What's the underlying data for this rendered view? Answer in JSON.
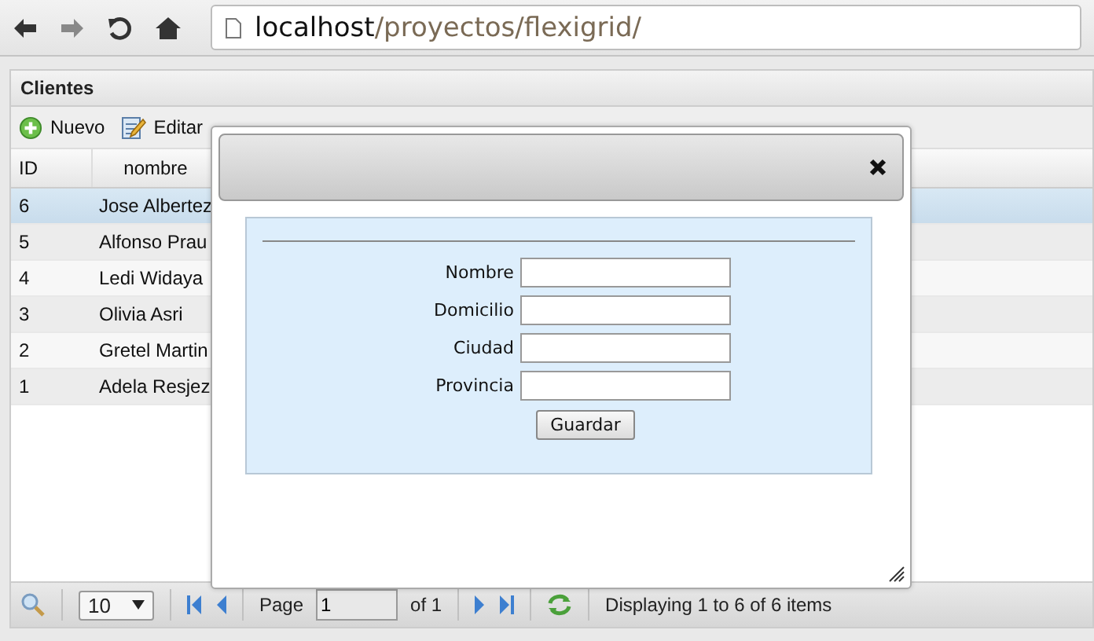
{
  "browser": {
    "url_host": "localhost",
    "url_path": "/proyectos/flexigrid/"
  },
  "grid": {
    "title": "Clientes",
    "toolbar": [
      {
        "label": "Nuevo",
        "kind": "add"
      },
      {
        "label": "Editar",
        "kind": "edit"
      }
    ],
    "columns": [
      "ID",
      "nombre"
    ],
    "rows": [
      {
        "cells": [
          "6",
          "Jose Albertez"
        ],
        "selected": true
      },
      {
        "cells": [
          "5",
          "Alfonso Prau"
        ],
        "selected": false
      },
      {
        "cells": [
          "4",
          "Ledi Widaya"
        ],
        "selected": false
      },
      {
        "cells": [
          "3",
          "Olivia Asri"
        ],
        "selected": false
      },
      {
        "cells": [
          "2",
          "Gretel Martin"
        ],
        "selected": false
      },
      {
        "cells": [
          "1",
          "Adela Resjez"
        ],
        "selected": false
      }
    ],
    "pager": {
      "per_page": "10",
      "page_label": "Page",
      "page": "1",
      "of_label": "of 1",
      "status": "Displaying 1 to 6 of 6 items"
    }
  },
  "dialog": {
    "fields": [
      {
        "label": "Nombre"
      },
      {
        "label": "Domicilio"
      },
      {
        "label": "Ciudad"
      },
      {
        "label": "Provincia"
      }
    ],
    "submit": "Guardar"
  }
}
